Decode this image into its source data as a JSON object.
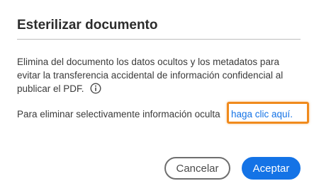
{
  "dialog": {
    "title": "Esterilizar documento",
    "description": "Elimina del documento los datos ocultos y los metadatos para evitar la transferencia accidental de información confidencial al publicar el PDF.",
    "info_icon": "info-circle-icon",
    "selective_text": "Para eliminar selectivamente información oculta",
    "link_text": "haga clic aquí.",
    "highlight_color": "#f08a1c",
    "link_color": "#1473e6"
  },
  "buttons": {
    "cancel_label": "Cancelar",
    "accept_label": "Aceptar",
    "accept_color": "#1473e6"
  }
}
